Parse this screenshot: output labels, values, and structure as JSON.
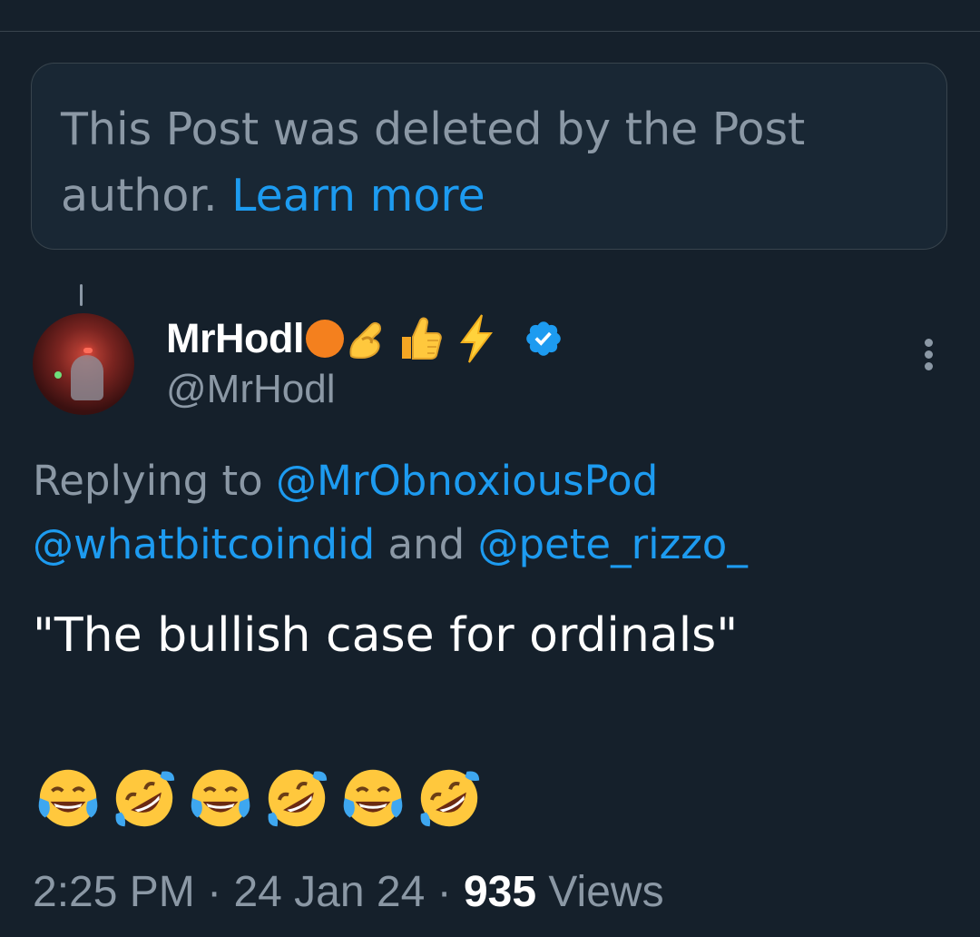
{
  "deleted_notice": {
    "text": "This Post was deleted by the Post author.",
    "link": "Learn more"
  },
  "author": {
    "display_name": "MrHodl",
    "handle": "@MrHodl",
    "name_emojis": [
      "orange-circle",
      "pinching-hand",
      "thumbs-up",
      "high-voltage"
    ],
    "verified_icon": "verified-badge-icon",
    "verified_color": "#1d9bf0"
  },
  "reply": {
    "prefix": "Replying to",
    "mentions": [
      "@MrObnoxiousPod",
      "@whatbitcoindid",
      "@pete_rizzo_"
    ],
    "and": "and"
  },
  "post": {
    "text": "\"The bullish case for ordinals\"",
    "emojis": [
      "face-with-tears-of-joy",
      "rolling-on-the-floor-laughing",
      "face-with-tears-of-joy",
      "rolling-on-the-floor-laughing",
      "face-with-tears-of-joy",
      "rolling-on-the-floor-laughing"
    ]
  },
  "meta": {
    "time": "2:25 PM",
    "separator": "·",
    "date": "24 Jan 24",
    "views_count": "935",
    "views_label": "Views"
  },
  "colors": {
    "background": "#15202b",
    "accent": "#1d9bf0",
    "muted": "#8b98a5",
    "border": "#38444d"
  }
}
